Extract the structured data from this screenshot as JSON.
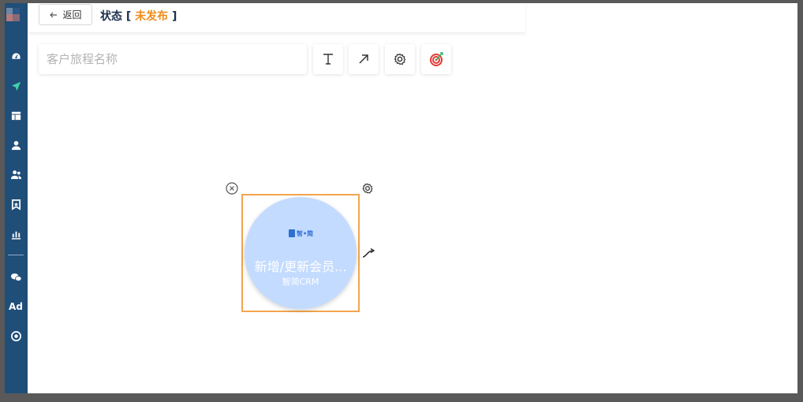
{
  "header": {
    "back_label": "返回",
    "title_prefix": "状态 [ ",
    "status": "未发布",
    "title_suffix": " ]"
  },
  "toolbar": {
    "name_placeholder": "客户旅程名称",
    "name_value": "",
    "buttons": [
      "text-tool",
      "arrow-tool",
      "settings",
      "goal-target"
    ]
  },
  "sidebar": {
    "items": [
      "dashboard-icon",
      "send-icon",
      "layout-icon",
      "user-icon",
      "users-icon",
      "bookmark-icon",
      "bar-chart-icon",
      "wechat-icon",
      "ad-icon",
      "plugin-icon"
    ],
    "ad_label": "Ad"
  },
  "node": {
    "title": "新增/更新会员...",
    "subtitle": "智简CRM",
    "logo_text": "智•简",
    "close_icon": "close-circle-icon",
    "gear_icon": "gear-icon",
    "link_icon": "connector-icon"
  },
  "colors": {
    "sidebar": "#1f4e79",
    "status": "#f08c1a",
    "node_fill": "#c3dbff",
    "node_border": "#f3a54d",
    "target_red": "#e53935"
  }
}
